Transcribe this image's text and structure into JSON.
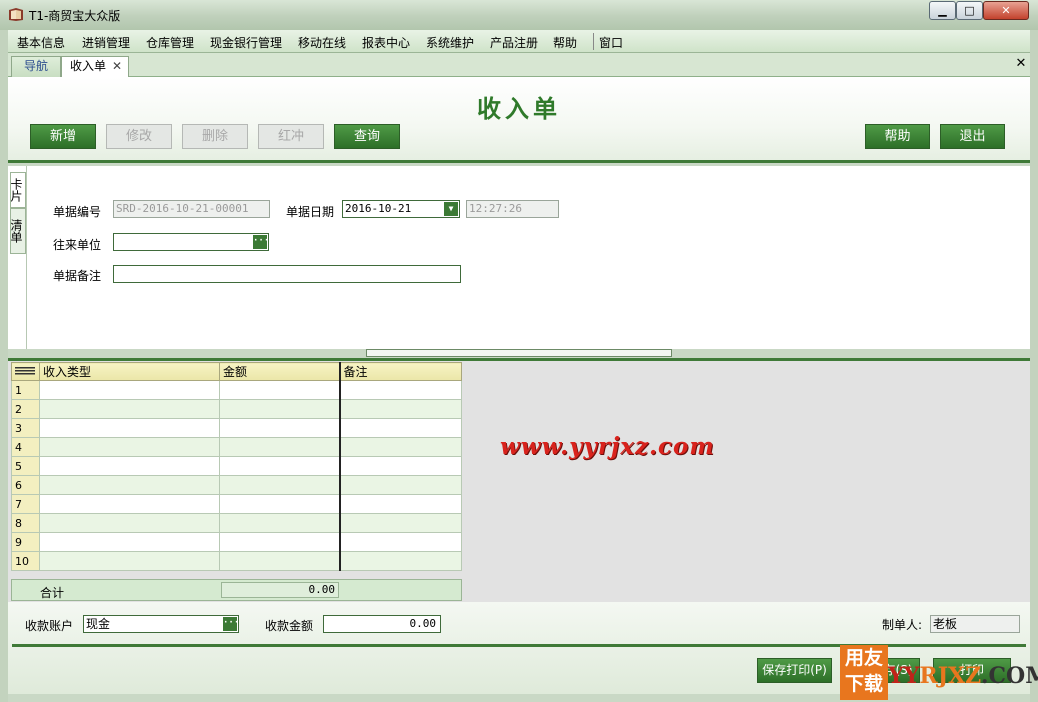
{
  "window": {
    "title": "T1-商贸宝大众版",
    "controls": {
      "minimize": "▁",
      "maximize": "□",
      "close": "✕"
    }
  },
  "menu": [
    "基本信息",
    "进销管理",
    "仓库管理",
    "现金银行管理",
    "移动在线",
    "报表中心",
    "系统维护",
    "产品注册",
    "帮助",
    "窗口"
  ],
  "tabs": {
    "nav": "导航",
    "active": "收入单",
    "close_symbol": "✕",
    "strip_close": "✕"
  },
  "header": {
    "title": "收入单",
    "buttons": {
      "new": "新增",
      "edit": "修改",
      "delete": "删除",
      "reverse": "红冲",
      "query": "查询",
      "help": "帮助",
      "exit": "退出"
    }
  },
  "side_tabs": [
    "卡片",
    "清单"
  ],
  "form": {
    "doc_no_label": "单据编号",
    "doc_no_value": "SRD-2016-10-21-00001",
    "doc_date_label": "单据日期",
    "doc_date_value": "2016-10-21",
    "doc_time_value": "12:27:26",
    "partner_label": "往来单位",
    "partner_value": "",
    "remark_label": "单据备注",
    "remark_value": "",
    "ellipsis": "···",
    "dropdown": "▼"
  },
  "grid": {
    "columns": [
      "收入类型",
      "金额",
      "备注"
    ],
    "rows": [
      "1",
      "2",
      "3",
      "4",
      "5",
      "6",
      "7",
      "8",
      "9",
      "10"
    ],
    "sum_label": "合计",
    "sum_value": "0.00"
  },
  "watermark": "www.yyrjxz.com",
  "footer": {
    "account_label": "收款账户",
    "account_value": "现金",
    "amount_label": "收款金额",
    "amount_value": "0.00",
    "maker_label": "制单人:",
    "maker_value": "老板",
    "btn_save_print": "保存打印(P)",
    "btn_save": "存(S)",
    "btn_print": "打印"
  },
  "logo": {
    "box_line1": "用友",
    "box_line2": "下载",
    "text_prefix": "YY",
    "text_mid": "RJXZ",
    "text_suffix": ".COM"
  },
  "colors": {
    "brand_green": "#3f7a38",
    "title_green": "#2f7a2a",
    "watermark_red": "#d9231d",
    "logo_orange": "#e8761e"
  }
}
